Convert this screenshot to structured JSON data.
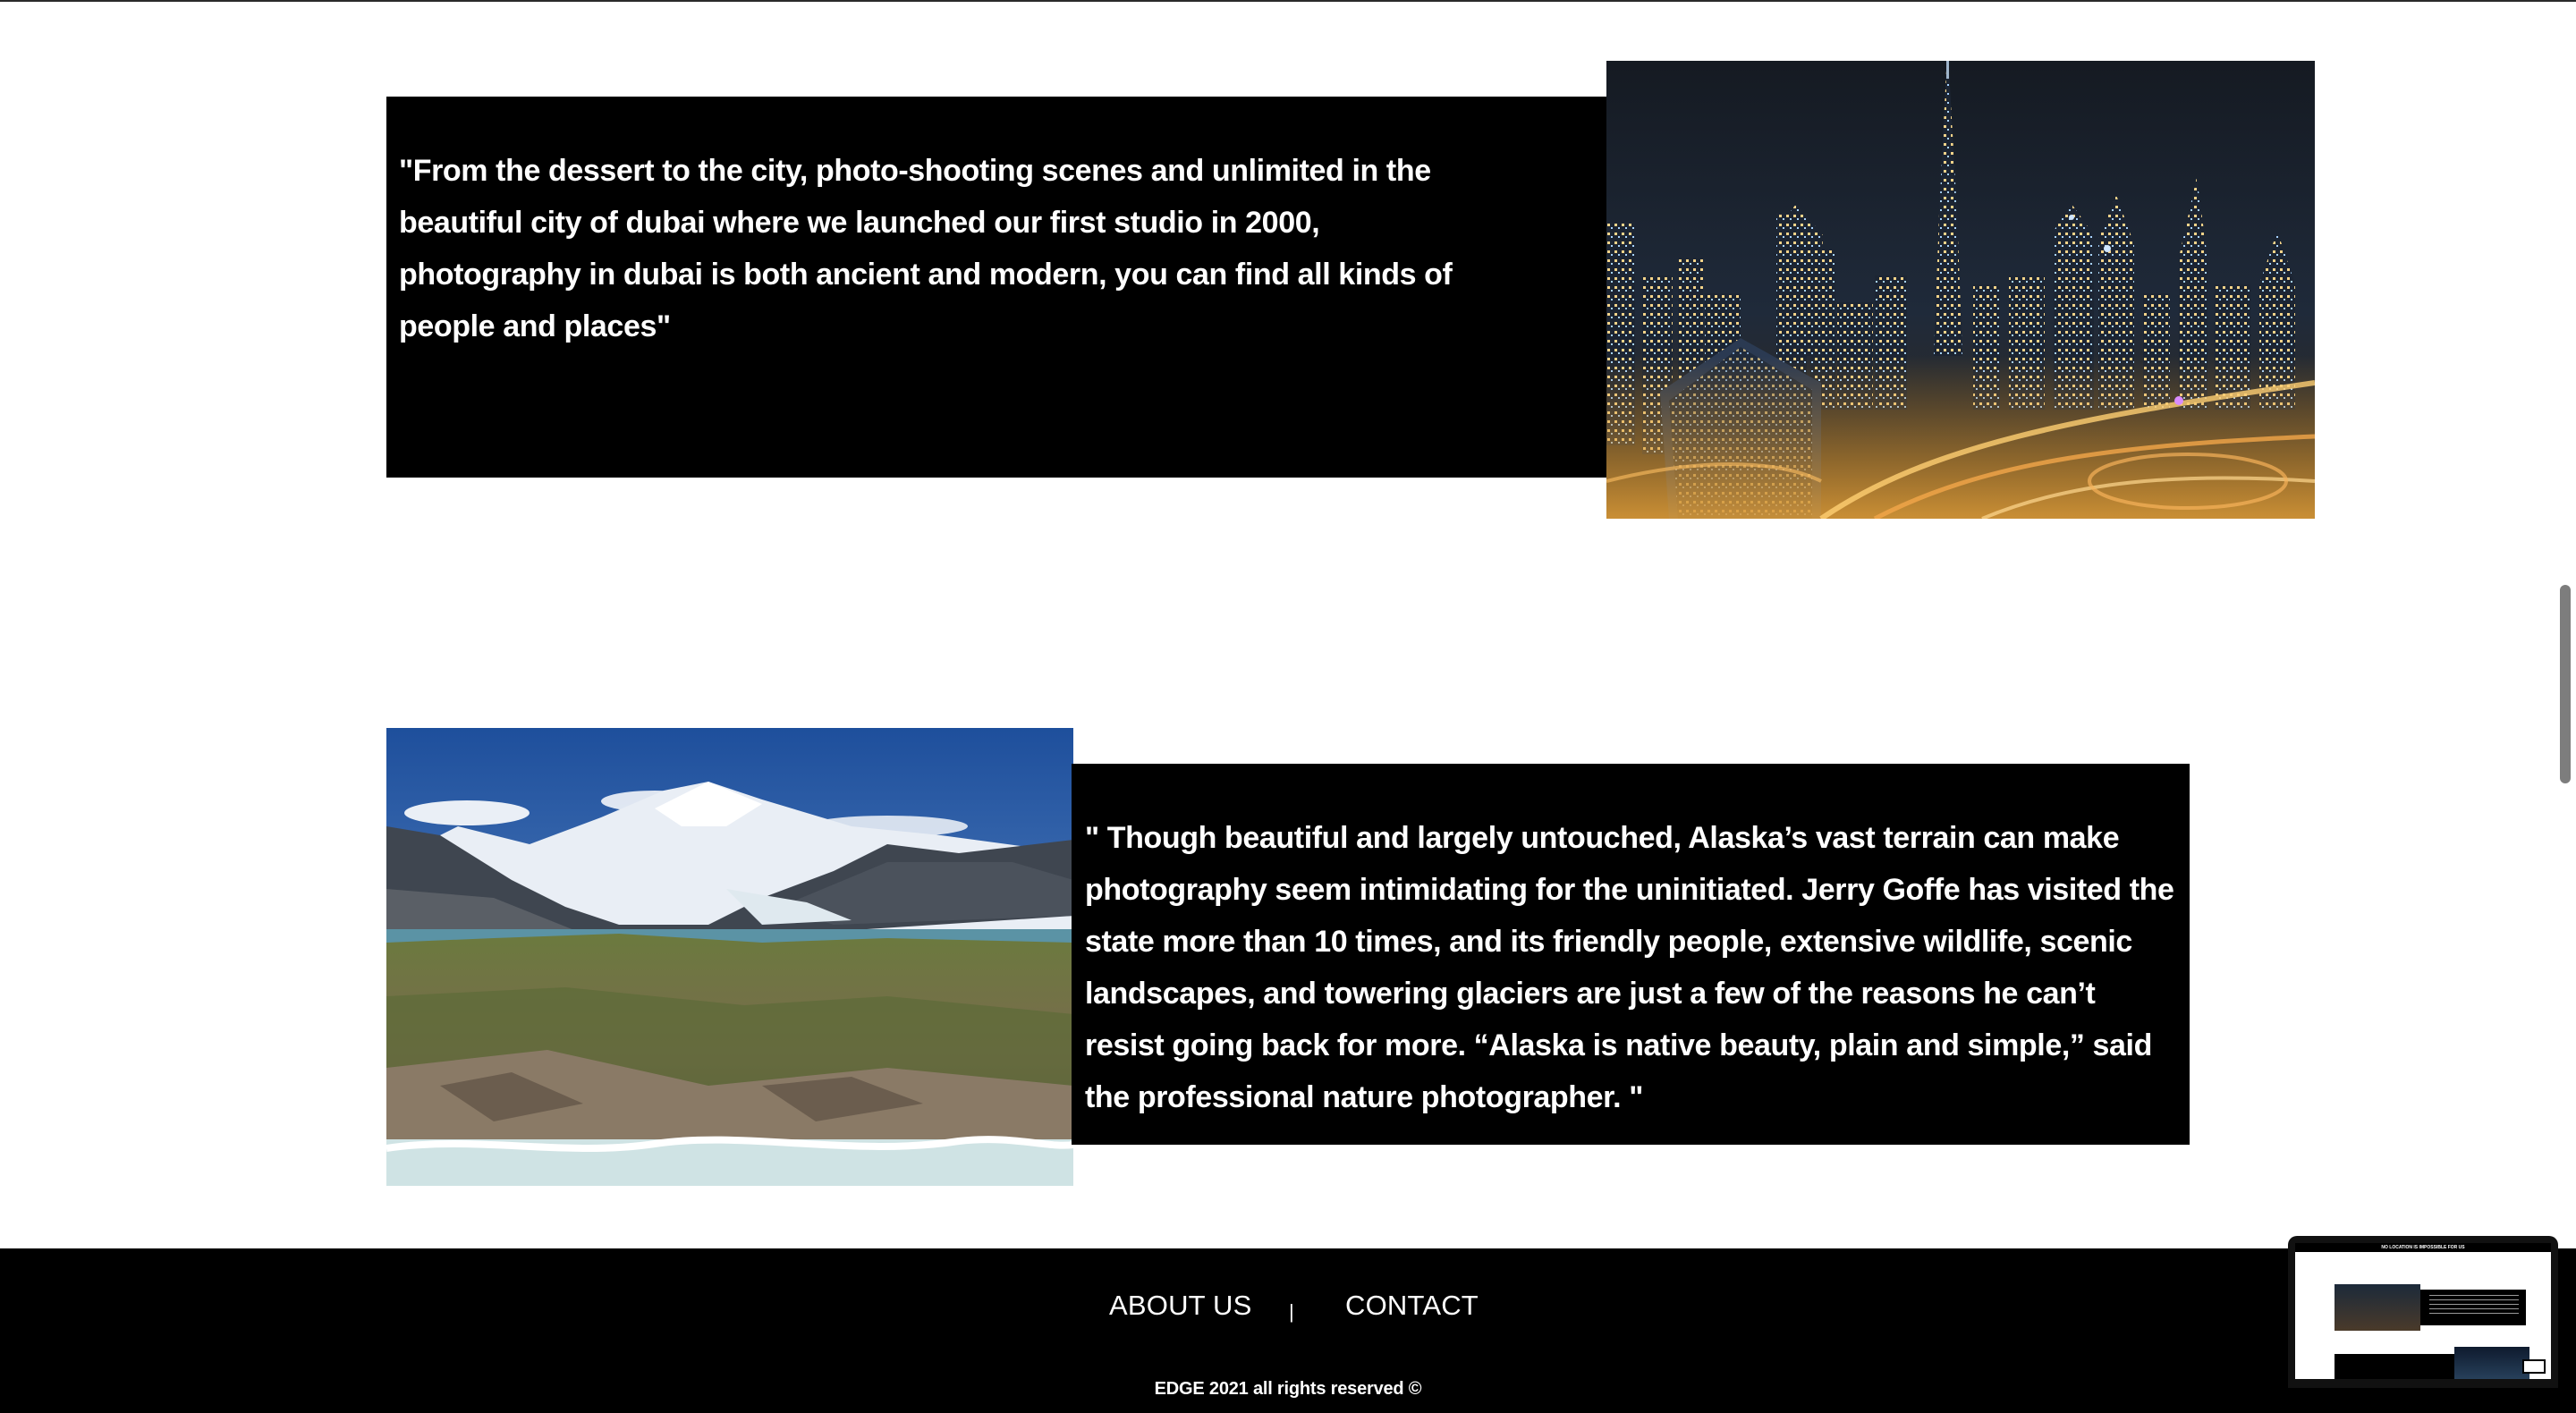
{
  "sections": {
    "dubai": {
      "quote": "\"From the dessert to the city, photo-shooting scenes and unlimited in the beautiful city of dubai where we launched our first studio in 2000, photography in dubai is both ancient and modern, you can find all kinds of people and places\""
    },
    "alaska": {
      "quote": "\" Though beautiful and largely untouched, Alaska’s vast terrain can make photography seem intimidating for the uninitiated. Jerry Goffe has visited the state more than 10 times, and its friendly people, extensive wildlife, scenic landscapes, and towering glaciers are just a few of the reasons he can’t resist going back for more. “Alaska is native beauty, plain and simple,” said the professional nature photographer. \""
    }
  },
  "footer": {
    "about_label": "ABOUT US",
    "separator": "|",
    "contact_label": "CONTACT",
    "copyright": "EDGE 2021 all rights reserved ©"
  },
  "preview": {
    "heading": "NO LOCATION IS IMPOSSIBLE FOR US"
  },
  "colors": {
    "page_background": "#ffffff",
    "text_box_background": "#000000",
    "text": "#ffffff",
    "footer_background": "#000000"
  },
  "icons": {
    "dubai_photo": "dubai-skyline-night-photo",
    "alaska_photo": "alaska-mountain-glacier-photo"
  }
}
